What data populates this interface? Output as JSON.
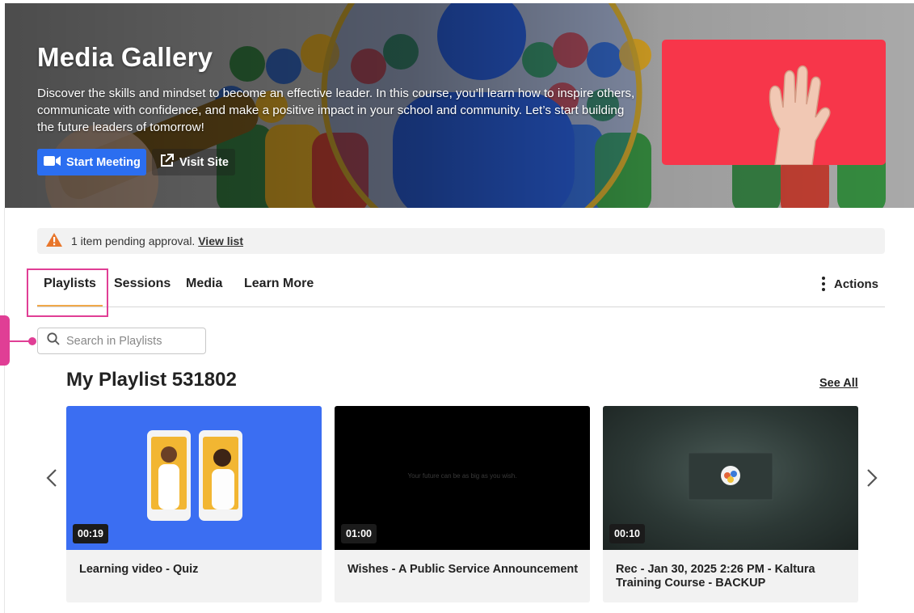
{
  "banner": {
    "title": "Media Gallery",
    "description": "Discover the skills and mindset to become an effective leader. In this course, you’ll learn how to inspire others, communicate with confidence, and make a positive impact in your school and community. Let’s start building the future leaders of tomorrow!",
    "start_meeting_label": "Start Meeting",
    "visit_site_label": "Visit Site",
    "icons": {
      "meeting": "video-camera-icon",
      "visit": "external-link-icon"
    },
    "colors": {
      "primary_button": "#2b6ef0",
      "thumbnail_bg": "#f7364a"
    }
  },
  "notice": {
    "icon": "warning-icon",
    "text": "1 item pending approval.",
    "link_label": "View list",
    "color": "#e8762b"
  },
  "tabs": {
    "items": [
      {
        "label": "Playlists",
        "active": true
      },
      {
        "label": "Sessions",
        "active": false
      },
      {
        "label": "Media",
        "active": false
      },
      {
        "label": "Learn More",
        "active": false
      }
    ],
    "actions_label": "Actions",
    "active_underline_color": "#f0a84a",
    "highlight_color": "#e03e95"
  },
  "search": {
    "placeholder": "Search in Playlists",
    "value": ""
  },
  "playlist": {
    "title": "My Playlist 531802",
    "see_all_label": "See All",
    "cards": [
      {
        "duration": "00:19",
        "title": "Learning video - Quiz"
      },
      {
        "duration": "01:00",
        "title": "Wishes - A Public Service Announcement",
        "overlay_text": "Your future can be as big as you wish."
      },
      {
        "duration": "00:10",
        "title": "Rec - Jan 30, 2025 2:26 PM - Kaltura Training Course - BACKUP"
      }
    ]
  }
}
